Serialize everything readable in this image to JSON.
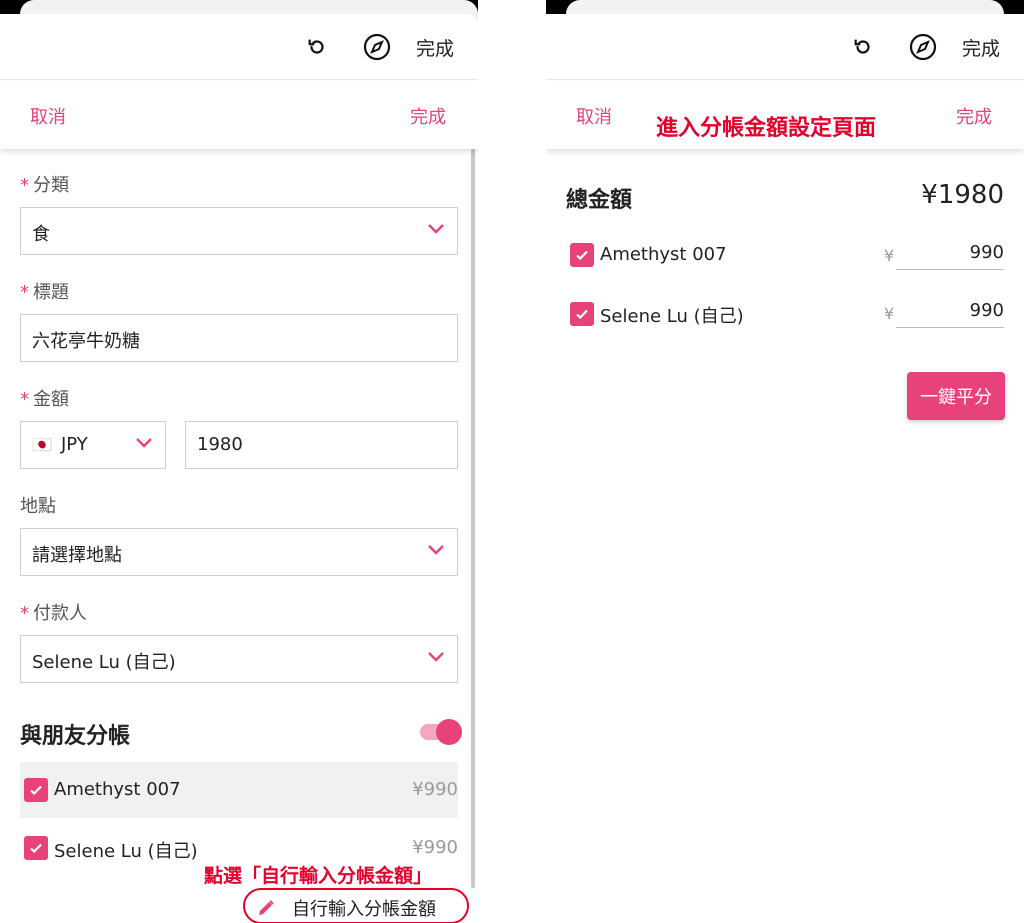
{
  "colors": {
    "accent": "#e8427a",
    "annotation": "#e4002b"
  },
  "browser": {
    "done_label": "完成",
    "icons": [
      "refresh-icon",
      "compass-icon"
    ]
  },
  "left": {
    "nav": {
      "cancel": "取消",
      "done": "完成"
    },
    "category": {
      "label": "分類",
      "value": "食"
    },
    "title": {
      "label": "標題",
      "value": "六花亭牛奶糖"
    },
    "amount": {
      "label": "金額",
      "currency": "JPY",
      "flag": "🇯🇵",
      "value": "1980"
    },
    "location": {
      "label": "地點",
      "value": "請選擇地點"
    },
    "payer": {
      "label": "付款人",
      "value": "Selene Lu (自己)"
    },
    "split": {
      "title": "與朋友分帳",
      "toggle_on": true,
      "members": [
        {
          "name": "Amethyst 007",
          "amount": "¥990"
        },
        {
          "name": "Selene Lu (自己)",
          "amount": "¥990"
        }
      ]
    },
    "custom_split_button": "自行輸入分帳金額",
    "annotation": "點選「自行輸入分帳金額」"
  },
  "right": {
    "nav": {
      "cancel": "取消",
      "done": "完成"
    },
    "annotation": "進入分帳金額設定頁面",
    "total": {
      "label": "總金額",
      "value": "¥1980"
    },
    "members": [
      {
        "name": "Amethyst 007",
        "yen": "¥",
        "amount": "990"
      },
      {
        "name": "Selene Lu (自己)",
        "yen": "¥",
        "amount": "990"
      }
    ],
    "split_evenly_button": "一鍵平分"
  }
}
